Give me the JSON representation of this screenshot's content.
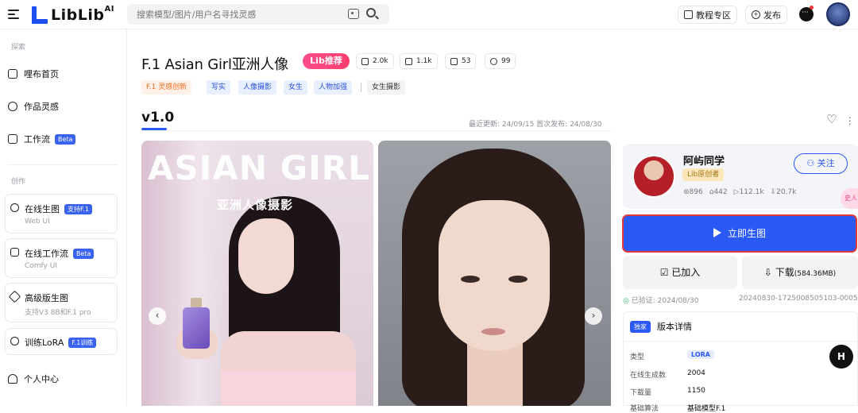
{
  "header": {
    "logo_text": "LibLib",
    "logo_sup": "AI",
    "search_placeholder": "搜索模型/图片/用户名寻找灵感",
    "tutorial_label": "教程专区",
    "publish_label": "发布"
  },
  "sidebar": {
    "section_explore": "探索",
    "items": [
      {
        "label": "哩布首页"
      },
      {
        "label": "作品灵感"
      },
      {
        "label": "工作流",
        "badge": "Beta"
      }
    ],
    "section_create": "创作",
    "cards": [
      {
        "title": "在线生图",
        "badge": "支持F.1",
        "sub": "Web UI"
      },
      {
        "title": "在线工作流",
        "badge": "Beta",
        "sub": "Comfy UI"
      },
      {
        "title": "高级版生图",
        "badge": "",
        "sub": "支持V3 8B和F.1 pro"
      },
      {
        "title": "训练LoRA",
        "badge": "F.1训练",
        "sub": ""
      }
    ],
    "personal": "个人中心"
  },
  "model": {
    "title": "F.1 Asian Girl亚洲人像",
    "lib_badge": "Lib推荐",
    "stats": {
      "runs": "2.0k",
      "downloads": "1.1k",
      "images": "53",
      "likes": "99"
    },
    "tags": {
      "featured": "F.1 灵感创新",
      "blue": [
        "写实",
        "人像摄影",
        "女生",
        "人物加强"
      ],
      "gray": "女生摄影"
    },
    "version": "v1.0",
    "dates": "最近更新: 24/09/15   首次发布: 24/08/30"
  },
  "gallery": {
    "img1_title": "ASIAN GIRL",
    "img1_sub": "亚洲人像摄影",
    "prev": "‹",
    "next": "›"
  },
  "author": {
    "name": "阿屿同学",
    "badge": "Lib原创者",
    "followers": "896",
    "uploads": "442",
    "runs": "112.1k",
    "downloads": "20.7k",
    "follow_label": "关注"
  },
  "actions": {
    "generate": "立即生图",
    "added": "已加入",
    "download": "下载",
    "download_size": "(584.36MB)",
    "verified": "已验证: 2024/08/30",
    "hash": "20240830-1725008505103-0005"
  },
  "details": {
    "exclusive": "独家",
    "title": "版本详情",
    "rows": [
      {
        "k": "类型",
        "v": "LORA"
      },
      {
        "k": "在线生成数",
        "v": "2004"
      },
      {
        "k": "下载量",
        "v": "1150"
      },
      {
        "k": "基础算法",
        "v": "基础模型F.1"
      }
    ]
  },
  "floating": {
    "h_label": "H",
    "pink_label": "史人"
  }
}
